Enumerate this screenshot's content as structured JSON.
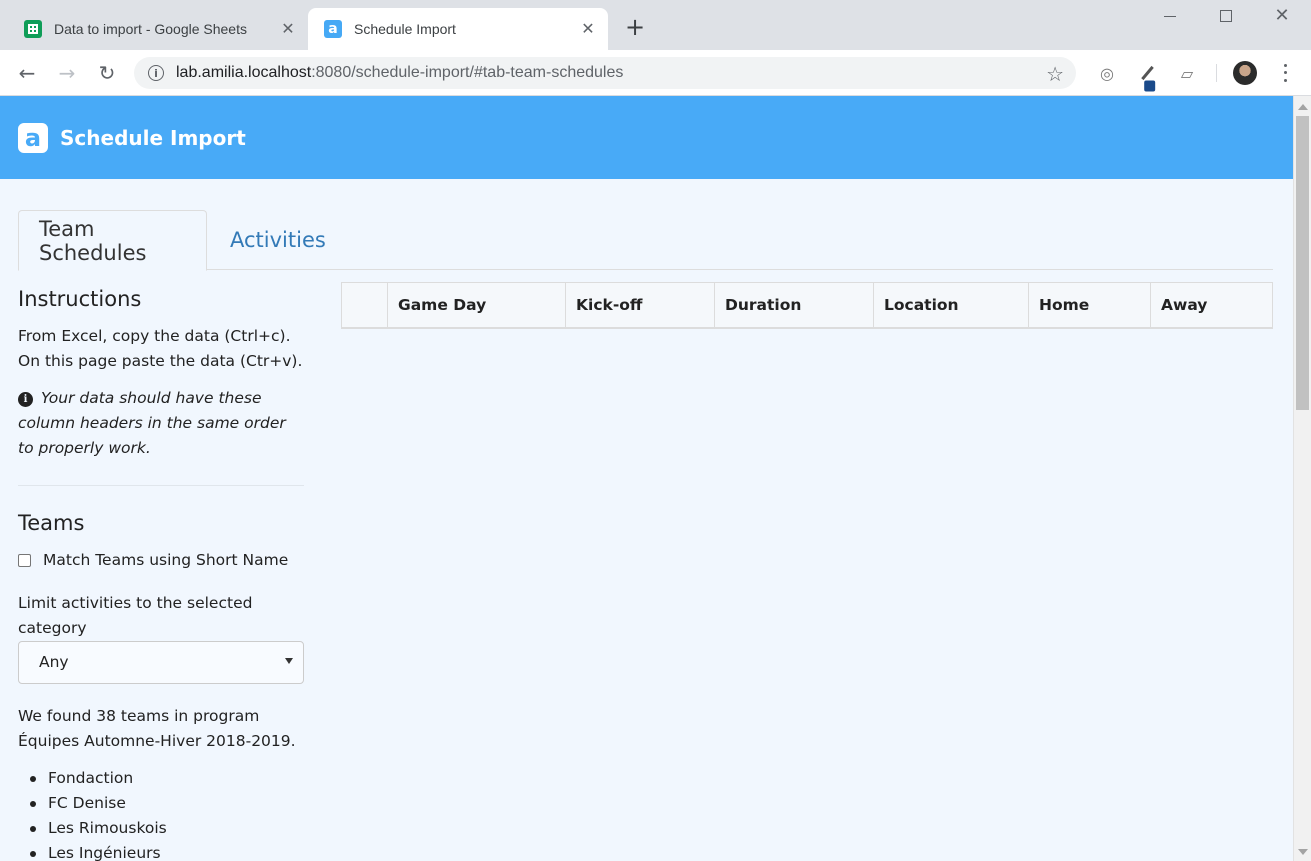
{
  "browser": {
    "tabs": [
      {
        "title": "Data to import - Google Sheets",
        "icon": "google-sheets-icon"
      },
      {
        "title": "Schedule Import",
        "icon": "amilia-icon"
      }
    ],
    "url_host": "lab.amilia.localhost",
    "url_rest": ":8080/schedule-import/#tab-team-schedules"
  },
  "app": {
    "logo_letter": "a",
    "title": "Schedule Import",
    "brand_color": "#48aaf7"
  },
  "page_tabs": [
    {
      "label": "Team Schedules",
      "active": true
    },
    {
      "label": "Activities",
      "active": false
    }
  ],
  "sidebar": {
    "instructions_heading": "Instructions",
    "instructions_text": "From Excel, copy the data (Ctrl+c). On this page paste the data (Ctr+v).",
    "instructions_note": "Your data should have these column headers in the same order to properly work.",
    "teams_heading": "Teams",
    "match_label": "Match Teams using Short Name",
    "match_checked": false,
    "limit_label": "Limit activities to the selected category",
    "category_selected": "Any",
    "found_text": "We found 38 teams in program Équipes Automne-Hiver 2018-2019.",
    "teams": [
      "Fondaction",
      "FC Denise",
      "Les Rimouskois",
      "Les Ingénieurs"
    ]
  },
  "table": {
    "columns": [
      "",
      "Game Day",
      "Kick-off",
      "Duration",
      "Location",
      "Home",
      "Away"
    ]
  }
}
